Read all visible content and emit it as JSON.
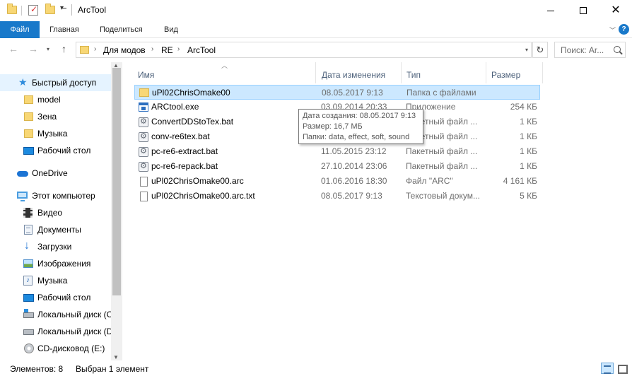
{
  "window": {
    "title": "ArcTool",
    "minimize_glyph": "—",
    "close_glyph": "✕"
  },
  "ribbon": {
    "tabs": [
      "Файл",
      "Главная",
      "Поделиться",
      "Вид"
    ]
  },
  "address": {
    "crumbs": [
      "Для модов",
      "RE",
      "ArcTool"
    ],
    "search_placeholder": "Поиск: Ar..."
  },
  "nav": {
    "items": [
      {
        "label": "Быстрый доступ",
        "icon": "star-icon"
      },
      {
        "label": "model",
        "icon": "folder-icon"
      },
      {
        "label": "Зена",
        "icon": "folder-icon"
      },
      {
        "label": "Музыка",
        "icon": "folder-icon"
      },
      {
        "label": "Рабочий стол",
        "icon": "desktop-icon"
      },
      {
        "label": "OneDrive",
        "icon": "cloud-icon"
      },
      {
        "label": "Этот компьютер",
        "icon": "computer-icon"
      },
      {
        "label": "Видео",
        "icon": "video-icon"
      },
      {
        "label": "Документы",
        "icon": "documents-icon"
      },
      {
        "label": "Загрузки",
        "icon": "download-icon"
      },
      {
        "label": "Изображения",
        "icon": "pictures-icon"
      },
      {
        "label": "Музыка",
        "icon": "music-icon"
      },
      {
        "label": "Рабочий стол",
        "icon": "desktop-icon"
      },
      {
        "label": "Локальный диск (C",
        "icon": "drive-icon"
      },
      {
        "label": "Локальный диск (D",
        "icon": "drive-icon"
      },
      {
        "label": "CD-дисковод (E:)",
        "icon": "cd-icon"
      }
    ]
  },
  "columns": {
    "name": "Имя",
    "date": "Дата изменения",
    "type": "Тип",
    "size": "Размер"
  },
  "files": [
    {
      "name": "uPl02ChrisOmake00",
      "date": "08.05.2017 9:13",
      "type": "Папка с файлами",
      "size": "",
      "icon": "folder-icon"
    },
    {
      "name": "ARCtool.exe",
      "date": "03.09.2014 20:33",
      "type": "Приложение",
      "size": "254 КБ",
      "icon": "exe-icon"
    },
    {
      "name": "ConvertDDStoTex.bat",
      "date": "",
      "type": "Пакетный файл ...",
      "size": "1 КБ",
      "icon": "bat-icon"
    },
    {
      "name": "conv-re6tex.bat",
      "date": "",
      "type": "Пакетный файл ...",
      "size": "1 КБ",
      "icon": "bat-icon"
    },
    {
      "name": "pc-re6-extract.bat",
      "date": "11.05.2015 23:12",
      "type": "Пакетный файл ...",
      "size": "1 КБ",
      "icon": "bat-icon"
    },
    {
      "name": "pc-re6-repack.bat",
      "date": "27.10.2014 23:06",
      "type": "Пакетный файл ...",
      "size": "1 КБ",
      "icon": "bat-icon"
    },
    {
      "name": "uPl02ChrisOmake00.arc",
      "date": "01.06.2016 18:30",
      "type": "Файл \"ARC\"",
      "size": "4 161 КБ",
      "icon": "file-icon"
    },
    {
      "name": "uPl02ChrisOmake00.arc.txt",
      "date": "08.05.2017 9:13",
      "type": "Текстовый докум...",
      "size": "5 КБ",
      "icon": "text-file-icon"
    }
  ],
  "tooltip": {
    "lines": [
      "Дата создания: 08.05.2017 9:13",
      "Размер: 16,7 МБ",
      "Папки: data, effect, soft, sound"
    ]
  },
  "status": {
    "count": "Элементов: 8",
    "selected": "Выбран 1 элемент"
  }
}
